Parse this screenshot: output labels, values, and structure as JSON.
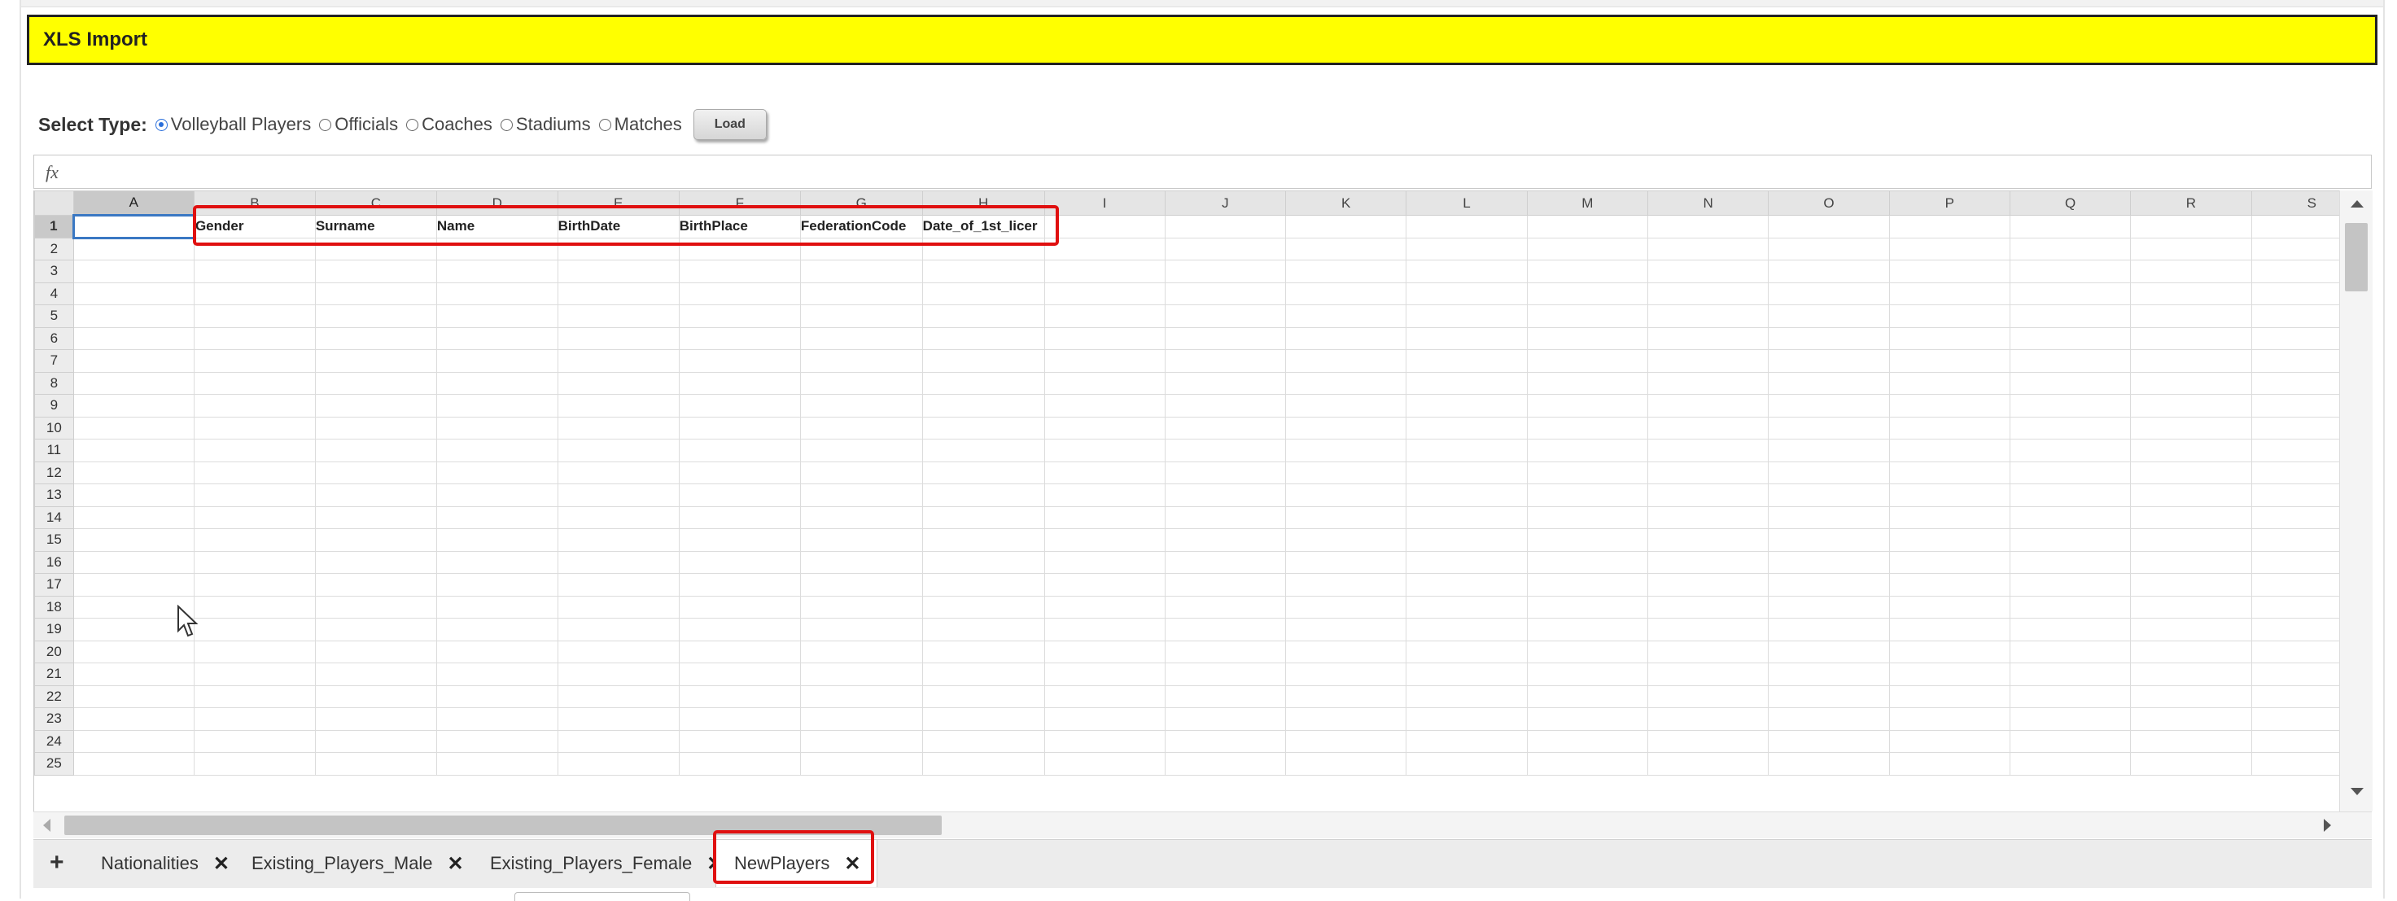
{
  "app": {
    "title": "XLS Import"
  },
  "select_type": {
    "label": "Select Type:",
    "options": [
      "Volleyball Players",
      "Officials",
      "Coaches",
      "Stadiums",
      "Matches"
    ],
    "selected": "Volleyball Players",
    "load_label": "Load"
  },
  "formula_bar": {
    "icon_label": "fx",
    "value": ""
  },
  "sheet": {
    "columns": [
      "A",
      "B",
      "C",
      "D",
      "E",
      "F",
      "G",
      "H",
      "I",
      "J",
      "K",
      "L",
      "M",
      "N",
      "O",
      "P",
      "Q",
      "R",
      "S"
    ],
    "row_numbers": [
      "1",
      "2",
      "3",
      "4",
      "5",
      "6",
      "7",
      "8",
      "9",
      "10",
      "11",
      "12",
      "13",
      "14",
      "15",
      "16",
      "17",
      "18",
      "19",
      "20",
      "21",
      "22",
      "23",
      "24",
      "25"
    ],
    "row1": [
      "",
      "Gender",
      "Surname",
      "Name",
      "BirthDate",
      "BirthPlace",
      "FederationCode",
      "Date_of_1st_licer"
    ],
    "active_cell": "A1"
  },
  "tabs": {
    "add_label": "+",
    "items": [
      {
        "label": "Nationalities"
      },
      {
        "label": "Existing_Players_Male"
      },
      {
        "label": "Existing_Players_Female"
      },
      {
        "label": "NewPlayers",
        "active": true
      }
    ],
    "close_glyph": "✕"
  },
  "colors": {
    "title_bg": "#ffff00",
    "highlight": "#e01010",
    "selection": "#3a78c3"
  }
}
